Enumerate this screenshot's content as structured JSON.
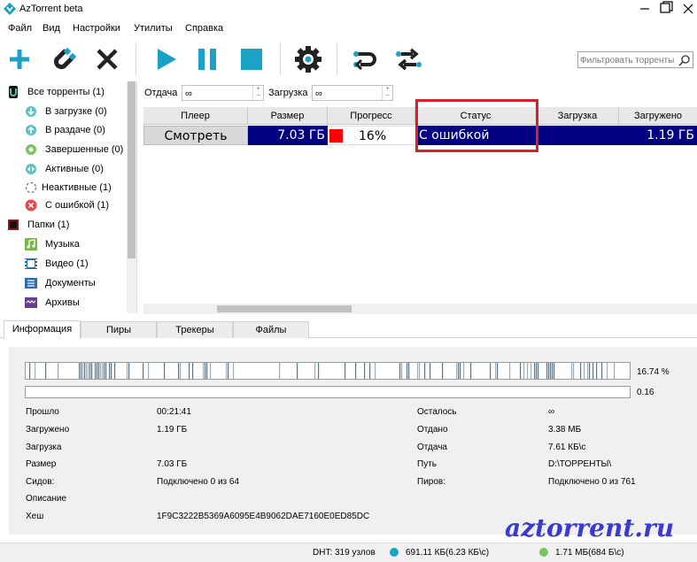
{
  "window": {
    "title": "AzTorrent beta"
  },
  "menu": [
    "Файл",
    "Вид",
    "Настройки",
    "Утилиты",
    "Справка"
  ],
  "toolbar": {
    "icons": [
      "plus-icon",
      "magnet-icon",
      "close-icon",
      "play-icon",
      "pause-icon",
      "stop-icon",
      "gear-icon",
      "reload-icon",
      "switch-icon"
    ],
    "filter_placeholder": "Фильтровать торренты"
  },
  "sidebar": {
    "items": [
      {
        "label": "Все торренты (1)",
        "icon": "torrent-icon"
      },
      {
        "label": "В загрузке (0)",
        "icon": "download-icon"
      },
      {
        "label": "В раздаче (0)",
        "icon": "upload-icon"
      },
      {
        "label": "Завершенные (0)",
        "icon": "check-icon"
      },
      {
        "label": "Активные (0)",
        "icon": "active-icon"
      },
      {
        "label": "Неактивные (1)",
        "icon": "inactive-icon"
      },
      {
        "label": "С ошибкой (1)",
        "icon": "error-icon"
      },
      {
        "label": "Папки (1)",
        "icon": "folder-icon"
      },
      {
        "label": "Музыка",
        "icon": "music-icon"
      },
      {
        "label": "Видео (1)",
        "icon": "video-icon"
      },
      {
        "label": "Документы",
        "icon": "document-icon"
      },
      {
        "label": "Архивы",
        "icon": "archive-icon"
      }
    ]
  },
  "limits": {
    "upload_label": "Отдача",
    "upload_value": "∞",
    "download_label": "Загрузка",
    "download_value": "∞"
  },
  "table": {
    "columns": [
      "Плеер",
      "Размер",
      "Прогресс",
      "Статус",
      "Загрузка",
      "Загружено"
    ],
    "row": {
      "player": "Смотреть",
      "size": "7.03 ГБ",
      "progress": "16%",
      "progress_fraction": 0.16,
      "status": "С ошибкой",
      "download": "",
      "downloaded": "1.19 ГБ"
    }
  },
  "tabs": [
    "Информация",
    "Пиры",
    "Трекеры",
    "Файлы"
  ],
  "info": {
    "pieces_percent": "16.74 %",
    "availability": "0.16",
    "left": [
      {
        "key": "Прошло",
        "value": "00:21:41"
      },
      {
        "key": "Загружено",
        "value": "1.19 ГБ"
      },
      {
        "key": "Загрузка",
        "value": ""
      },
      {
        "key": "Размер",
        "value": "7.03 ГБ"
      },
      {
        "key": "Сидов:",
        "value": "Подключено 0 из 64"
      },
      {
        "key": "Описание",
        "value": ""
      },
      {
        "key": "Хеш",
        "value": "1F9C3222B5369A6095E4B9062DAE7160E0ED85DC"
      }
    ],
    "right": [
      {
        "key": "Осталось",
        "value": "∞"
      },
      {
        "key": "Отдано",
        "value": "3.38 МБ"
      },
      {
        "key": "Отдача",
        "value": "7.61 КБ\\с"
      },
      {
        "key": "Путь",
        "value": "D:\\ТОРРЕНТЫ\\"
      },
      {
        "key": "Пиров:",
        "value": "Подключено 0 из 761"
      }
    ]
  },
  "watermark": "aztorrent.ru",
  "statusbar": {
    "dht": "DHT: 319 узлов",
    "down": "691.11 КБ(6.23 КБ\\с)",
    "up": "1.71 МБ(684 Б\\с)"
  },
  "colors": {
    "accent": "#1ba1c6",
    "selected_row": "#000080",
    "error_red": "#ff0000",
    "highlight_box": "#d8202a"
  }
}
